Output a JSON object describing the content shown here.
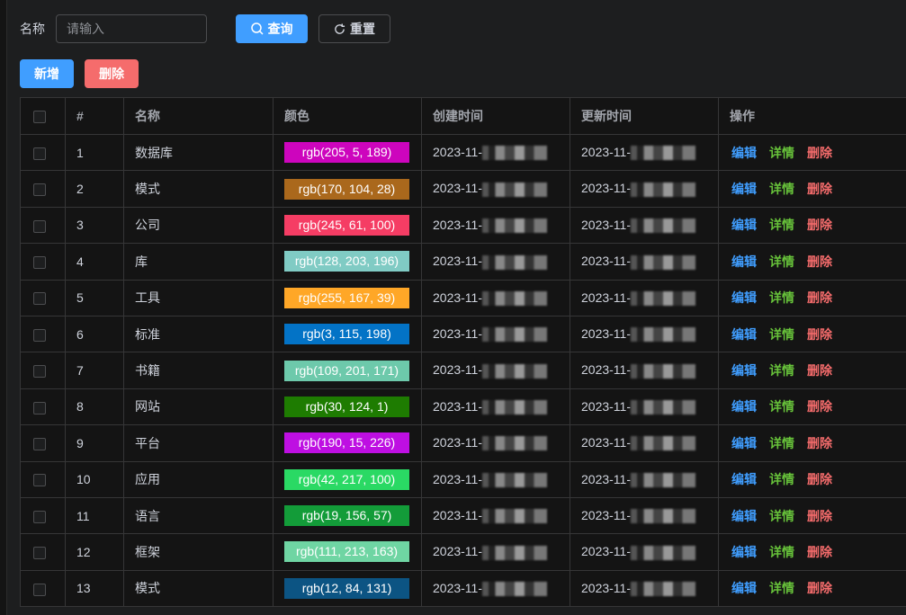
{
  "search": {
    "label": "名称",
    "placeholder": "请输入",
    "query": "查询",
    "reset": "重置"
  },
  "toolbar": {
    "add": "新增",
    "delete": "删除"
  },
  "colors": {
    "primary": "#409eff",
    "danger": "#f56c6c",
    "success": "#67c23a"
  },
  "table": {
    "headers": [
      "#",
      "名称",
      "颜色",
      "创建时间",
      "更新时间",
      "操作"
    ],
    "actions": {
      "edit": "编辑",
      "detail": "详情",
      "delete": "删除"
    },
    "rows": [
      {
        "id": "1",
        "name": "数据库",
        "color": "rgb(205, 5, 189)",
        "created": "2023-11-",
        "updated": "2023-11-"
      },
      {
        "id": "2",
        "name": "模式",
        "color": "rgb(170, 104, 28)",
        "created": "2023-11-",
        "updated": "2023-11-"
      },
      {
        "id": "3",
        "name": "公司",
        "color": "rgb(245, 61, 100)",
        "created": "2023-11-",
        "updated": "2023-11-"
      },
      {
        "id": "4",
        "name": "库",
        "color": "rgb(128, 203, 196)",
        "created": "2023-11-",
        "updated": "2023-11-"
      },
      {
        "id": "5",
        "name": "工具",
        "color": "rgb(255, 167, 39)",
        "created": "2023-11-",
        "updated": "2023-11-"
      },
      {
        "id": "6",
        "name": "标准",
        "color": "rgb(3, 115, 198)",
        "created": "2023-11-",
        "updated": "2023-11-"
      },
      {
        "id": "7",
        "name": "书籍",
        "color": "rgb(109, 201, 171)",
        "created": "2023-11-",
        "updated": "2023-11-"
      },
      {
        "id": "8",
        "name": "网站",
        "color": "rgb(30, 124, 1)",
        "created": "2023-11-",
        "updated": "2023-11-"
      },
      {
        "id": "9",
        "name": "平台",
        "color": "rgb(190, 15, 226)",
        "created": "2023-11-",
        "updated": "2023-11-"
      },
      {
        "id": "10",
        "name": "应用",
        "color": "rgb(42, 217, 100)",
        "created": "2023-11-",
        "updated": "2023-11-"
      },
      {
        "id": "11",
        "name": "语言",
        "color": "rgb(19, 156, 57)",
        "created": "2023-11-",
        "updated": "2023-11-"
      },
      {
        "id": "12",
        "name": "框架",
        "color": "rgb(111, 213, 163)",
        "created": "2023-11-",
        "updated": "2023-11-"
      },
      {
        "id": "13",
        "name": "模式",
        "color": "rgb(12, 84, 131)",
        "created": "2023-11-",
        "updated": "2023-11-"
      }
    ]
  }
}
